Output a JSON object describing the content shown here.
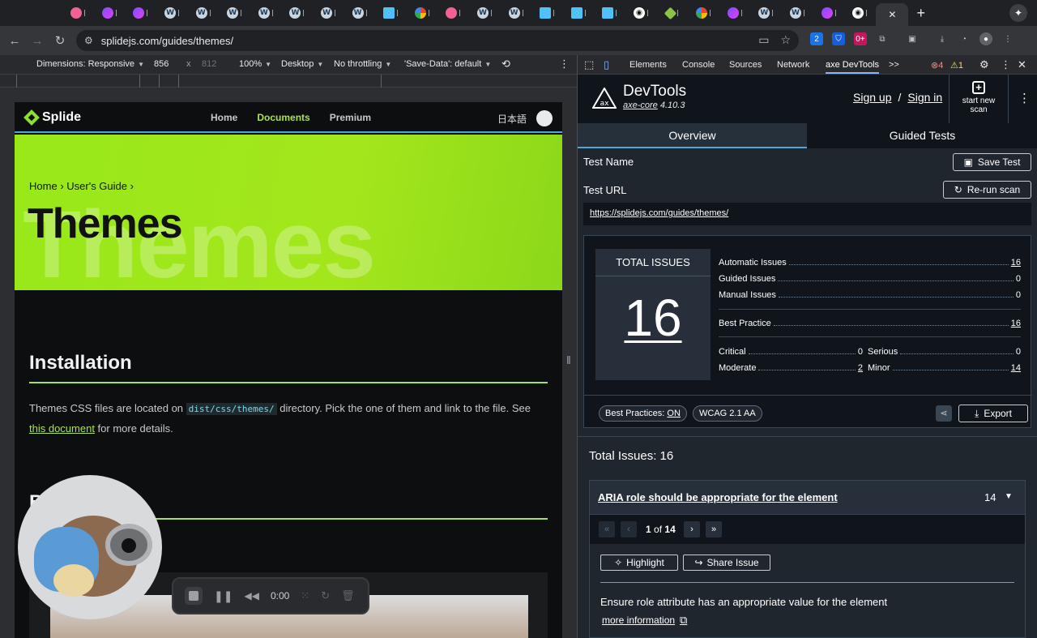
{
  "browser": {
    "tab_count_icons": [
      "rec",
      "purple",
      "purple",
      "wp",
      "wp",
      "wp",
      "wp",
      "wp",
      "wp",
      "wp",
      "blue",
      "ggl",
      "rec",
      "wp",
      "wp",
      "blue",
      "blue",
      "blue",
      "gh",
      "green",
      "ggl",
      "purple",
      "wp",
      "wp",
      "purple",
      "gh"
    ],
    "active_tab_close": "✕",
    "new_tab": "+",
    "url": "splidejs.com/guides/themes/",
    "ext_badge": "2",
    "ext_badge2": "0+"
  },
  "device_toolbar": {
    "dimensions_label": "Dimensions: Responsive",
    "width": "856",
    "times": "x",
    "height": "812",
    "zoom": "100%",
    "device": "Desktop",
    "throttling": "No throttling",
    "save_data": "'Save-Data': default"
  },
  "devtools_tabs": {
    "elements": "Elements",
    "console": "Console",
    "sources": "Sources",
    "network": "Network",
    "axe": "axe DevTools",
    "more": ">>",
    "errors": "4",
    "warnings": "1"
  },
  "site": {
    "logo": "Splide",
    "nav": [
      "Home",
      "Documents",
      "Premium"
    ],
    "lang": "日本語",
    "breadcrumb_home": "Home",
    "breadcrumb_guide": "User's Guide",
    "hero_title": "Themes",
    "hero_bg": "Themes",
    "section1_title": "Installation",
    "para_before": "Themes CSS files are located on ",
    "para_code": "dist/css/themes/",
    "para_mid": " directory. Pick the one of them and link to the file. See ",
    "para_link": "this document",
    "para_after": " for more details.",
    "section2_title": "B"
  },
  "recorder": {
    "time": "0:00"
  },
  "axe": {
    "title": "DevTools",
    "core_label": "axe-core",
    "core_version": "4.10.3",
    "sign_up": "Sign up",
    "slash": "/",
    "sign_in": "Sign in",
    "new_scan_line1": "start new",
    "new_scan_line2": "scan",
    "tab_overview": "Overview",
    "tab_guided": "Guided Tests",
    "test_name_label": "Test Name",
    "save_test": "Save Test",
    "test_url_label": "Test URL",
    "rerun": "Re-run scan",
    "test_url": "https://splidejs.com/guides/themes/",
    "total_issues_label": "TOTAL ISSUES",
    "total_issues": "16",
    "stats": {
      "automatic_label": "Automatic Issues",
      "automatic": "16",
      "guided_label": "Guided Issues",
      "guided": "0",
      "manual_label": "Manual Issues",
      "manual": "0",
      "best_practice_label": "Best Practice",
      "best_practice": "16",
      "critical_label": "Critical",
      "critical": "0",
      "serious_label": "Serious",
      "serious": "0",
      "moderate_label": "Moderate",
      "moderate": "2",
      "minor_label": "Minor",
      "minor": "14"
    },
    "chip_best_practices": "Best Practices:",
    "chip_best_practices_value": "ON",
    "chip_wcag": "WCAG 2.1 AA",
    "export": "Export",
    "total_issues_heading": "Total Issues: 16",
    "issue": {
      "title": "ARIA role should be appropriate for the element",
      "count": "14",
      "page_current": "1",
      "page_of": "of",
      "page_total": "14",
      "highlight": "Highlight",
      "share": "Share Issue",
      "description": "Ensure role attribute has an appropriate value for the element",
      "more_info": "more information"
    }
  }
}
